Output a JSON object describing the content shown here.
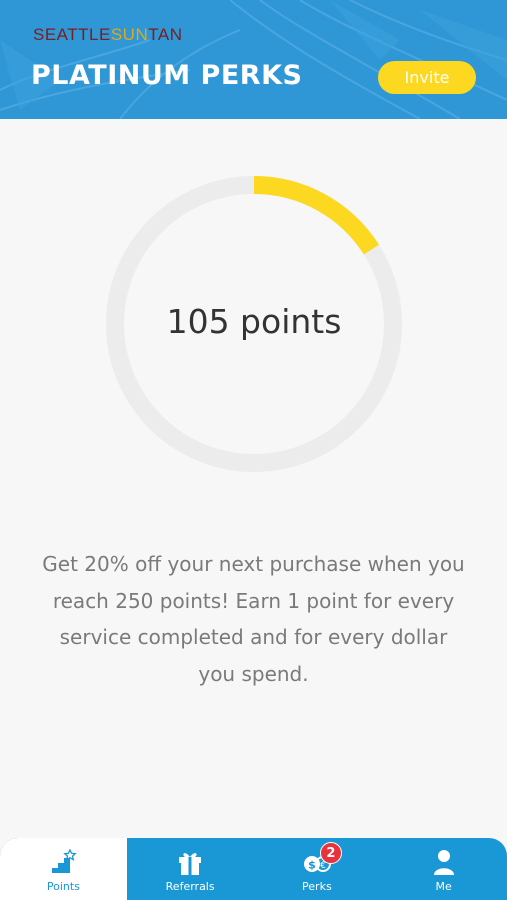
{
  "header": {
    "brand_part1": "SEATTLE",
    "brand_part2": "SUN",
    "brand_part3": "TAN",
    "title": "PLATINUM PERKS",
    "invite_label": "Invite"
  },
  "progress": {
    "points_text": "105 points",
    "fraction": 0.16
  },
  "description": "Get 20% off your next purchase when you reach 250 points! Earn 1 point for every service completed and for every dollar you spend.",
  "tabs": [
    {
      "label": "Points",
      "icon": "points-stairs-star-icon",
      "active": true
    },
    {
      "label": "Referrals",
      "icon": "gift-icon",
      "active": false
    },
    {
      "label": "Perks",
      "icon": "perks-coins-icon",
      "active": false,
      "badge": "2"
    },
    {
      "label": "Me",
      "icon": "person-icon",
      "active": false
    }
  ],
  "colors": {
    "header_bg": "#2f97d6",
    "accent_yellow": "#fdd820",
    "ring_track": "#ececec",
    "tabbar": "#1a97d5",
    "badge_red": "#e8323c"
  }
}
